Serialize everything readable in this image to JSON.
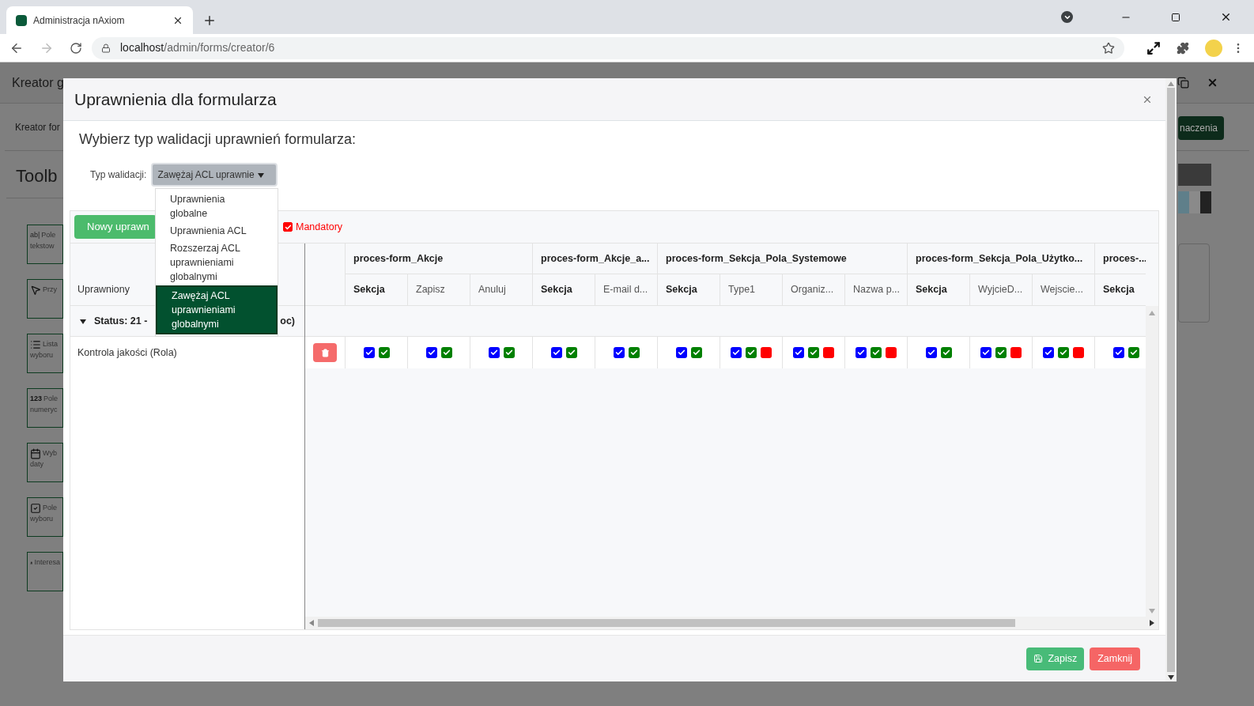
{
  "browser": {
    "tab_title": "Administracja nAxiom",
    "url_host": "localhost",
    "url_path": "/admin/forms/creator/6"
  },
  "background": {
    "header_title": "Kreator g",
    "breadcrumb": "Kreator for",
    "toolbox_title": "Toolb",
    "right_button": "naczenia",
    "toolbox_items": [
      {
        "kind": "text",
        "icon_text": "ab|",
        "lines": [
          "Pole",
          "tekstow"
        ]
      },
      {
        "kind": "pointer",
        "lines": [
          "Przy"
        ]
      },
      {
        "kind": "list",
        "lines": [
          "Lista",
          "wyboru"
        ]
      },
      {
        "kind": "number",
        "icon_text": "123",
        "lines": [
          "Pole",
          "numeryc"
        ]
      },
      {
        "kind": "date",
        "lines": [
          "Wyb",
          "daty"
        ]
      },
      {
        "kind": "checkbox",
        "lines": [
          "Pole",
          "wyboru"
        ]
      },
      {
        "kind": "person",
        "lines": [
          "Interesa"
        ]
      }
    ]
  },
  "modal": {
    "title": "Uprawnienia dla formularza",
    "subtitle": "Wybierz typ walidacji uprawnień formularza:",
    "validation": {
      "label": "Typ walidacji:",
      "value": "Zawężaj ACL uprawnie",
      "options": [
        {
          "label": "Uprawnienia globalne",
          "selected": false
        },
        {
          "label": "Uprawnienia ACL",
          "selected": false
        },
        {
          "label": "Rozszerzaj ACL uprawnieniami globalnymi",
          "selected": false
        },
        {
          "label": "Zawężaj ACL uprawnieniami globalnymi",
          "selected": true
        }
      ]
    },
    "new_button": "Nowy uprawn",
    "mandatory": {
      "label": "Mandatory",
      "checked": true
    },
    "grantee_header": "Uprawniony",
    "status_group": {
      "label": "Status: 21 -",
      "tail": "oc)",
      "expanded": true
    },
    "rows": [
      {
        "name": "Kontrola jakości (Rola)"
      }
    ],
    "groups": [
      {
        "title": "proces-form_Akcje",
        "columns": [
          {
            "label": "Sekcja",
            "kind": "section",
            "checks": [
              {
                "color": "#0000ff",
                "checked": true
              },
              {
                "color": "#008000",
                "checked": true
              }
            ]
          },
          {
            "label": "Zapisz",
            "kind": "field",
            "checks": [
              {
                "color": "#0000ff",
                "checked": true
              },
              {
                "color": "#008000",
                "checked": true
              }
            ]
          },
          {
            "label": "Anuluj",
            "kind": "field",
            "checks": [
              {
                "color": "#0000ff",
                "checked": true
              },
              {
                "color": "#008000",
                "checked": true
              }
            ]
          }
        ]
      },
      {
        "title": "proces-form_Akcje_a...",
        "columns": [
          {
            "label": "Sekcja",
            "kind": "section",
            "checks": [
              {
                "color": "#0000ff",
                "checked": true
              },
              {
                "color": "#008000",
                "checked": true
              }
            ]
          },
          {
            "label": "E-mail d...",
            "kind": "field",
            "checks": [
              {
                "color": "#0000ff",
                "checked": true
              },
              {
                "color": "#008000",
                "checked": true
              }
            ]
          }
        ]
      },
      {
        "title": "proces-form_Sekcja_Pola_Systemowe",
        "columns": [
          {
            "label": "Sekcja",
            "kind": "section",
            "checks": [
              {
                "color": "#0000ff",
                "checked": true
              },
              {
                "color": "#008000",
                "checked": true
              }
            ]
          },
          {
            "label": "Type1",
            "kind": "field",
            "checks": [
              {
                "color": "#0000ff",
                "checked": true
              },
              {
                "color": "#008000",
                "checked": true
              },
              {
                "color": "#ff0000",
                "checked": false
              }
            ]
          },
          {
            "label": "Organiz...",
            "kind": "field",
            "checks": [
              {
                "color": "#0000ff",
                "checked": true
              },
              {
                "color": "#008000",
                "checked": true
              },
              {
                "color": "#ff0000",
                "checked": false
              }
            ]
          },
          {
            "label": "Nazwa p...",
            "kind": "field",
            "checks": [
              {
                "color": "#0000ff",
                "checked": true
              },
              {
                "color": "#008000",
                "checked": true
              },
              {
                "color": "#ff0000",
                "checked": false
              }
            ]
          }
        ]
      },
      {
        "title": "proces-form_Sekcja_Pola_Użytko...",
        "columns": [
          {
            "label": "Sekcja",
            "kind": "section",
            "checks": [
              {
                "color": "#0000ff",
                "checked": true
              },
              {
                "color": "#008000",
                "checked": true
              }
            ]
          },
          {
            "label": "WyjcieD...",
            "kind": "field",
            "checks": [
              {
                "color": "#0000ff",
                "checked": true
              },
              {
                "color": "#008000",
                "checked": true
              },
              {
                "color": "#ff0000",
                "checked": false
              }
            ]
          },
          {
            "label": "Wejscie...",
            "kind": "field",
            "checks": [
              {
                "color": "#0000ff",
                "checked": true
              },
              {
                "color": "#008000",
                "checked": true
              },
              {
                "color": "#ff0000",
                "checked": false
              }
            ]
          }
        ]
      },
      {
        "title": "proces-...",
        "columns": [
          {
            "label": "Sekcja",
            "kind": "section",
            "checks": [
              {
                "color": "#0000ff",
                "checked": true
              },
              {
                "color": "#008000",
                "checked": true
              }
            ]
          }
        ]
      }
    ],
    "save_button": "Zapisz",
    "close_button": "Zamknij"
  }
}
